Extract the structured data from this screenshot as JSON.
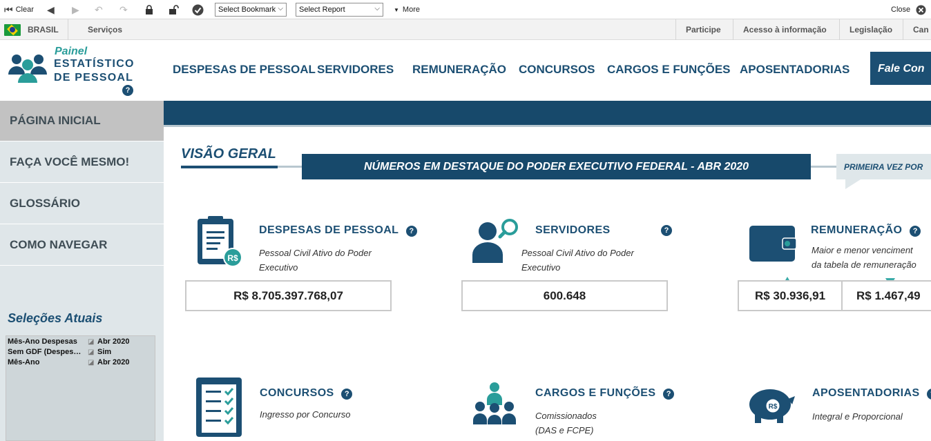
{
  "toolbar": {
    "clear_label": "Clear",
    "bookmark_select": "Select Bookmark",
    "report_select": "Select Report",
    "more_label": "More",
    "close_label": "Close"
  },
  "gov_bar": {
    "country": "BRASIL",
    "services": "Serviços",
    "links": [
      "Participe",
      "Acesso à informação",
      "Legislação",
      "Can"
    ]
  },
  "logo": {
    "painel": "Painel",
    "line1": "ESTATÍSTICO",
    "line2": "DE PESSOAL",
    "help": "?"
  },
  "nav": {
    "items": [
      "DESPESAS DE PESSOAL",
      "SERVIDORES",
      "REMUNERAÇÃO",
      "CONCURSOS",
      "CARGOS E FUNÇÕES",
      "APOSENTADORIAS"
    ],
    "contact_button": "Fale Con"
  },
  "sidebar": {
    "items": [
      "PÁGINA INICIAL",
      "FAÇA VOCÊ MESMO!",
      "GLOSSÁRIO",
      "COMO NAVEGAR"
    ],
    "active_index": 0,
    "selections_title": "Seleções Atuais",
    "selections": [
      {
        "field": "Mês-Ano Despesas",
        "value": "Abr 2020"
      },
      {
        "field": "Sem GDF (Despes…",
        "value": "Sim"
      },
      {
        "field": "Mês-Ano",
        "value": "Abr 2020"
      }
    ]
  },
  "main": {
    "section_title": "VISÃO GERAL",
    "banner": "NÚMEROS EM DESTAQUE DO PODER EXECUTIVO FEDERAL - ABR 2020",
    "first_time": "PRIMEIRA VEZ POR",
    "cards": [
      {
        "title": "DESPESAS DE PESSOAL",
        "sub1": "Pessoal Civil Ativo do Poder",
        "sub2": "Executivo",
        "value": "R$ 8.705.397.768,07",
        "icon": "clipboard-money-icon"
      },
      {
        "title": "SERVIDORES",
        "sub1": "Pessoal Civil Ativo do Poder",
        "sub2": "Executivo",
        "value": "600.648",
        "icon": "person-search-icon"
      },
      {
        "title": "REMUNERAÇÃO",
        "sub1": "Maior e menor venciment",
        "sub2": "da tabela de remuneração",
        "value_max": "R$ 30.936,91",
        "value_min": "R$ 1.467,49",
        "icon": "wallet-icon"
      },
      {
        "title": "CONCURSOS",
        "sub1": "Ingresso por Concurso",
        "sub2": "",
        "icon": "checklist-icon"
      },
      {
        "title": "CARGOS E FUNÇÕES",
        "sub1": "Comissionados",
        "sub2": "(DAS e FCPE)",
        "icon": "team-icon"
      },
      {
        "title": "APOSENTADORIAS",
        "sub1": "Integral e Proporcional",
        "sub2": "",
        "icon": "piggy-bank-icon"
      }
    ]
  },
  "colors": {
    "navy": "#1c4f73",
    "teal": "#2a9d9a",
    "banner": "#17496b"
  }
}
